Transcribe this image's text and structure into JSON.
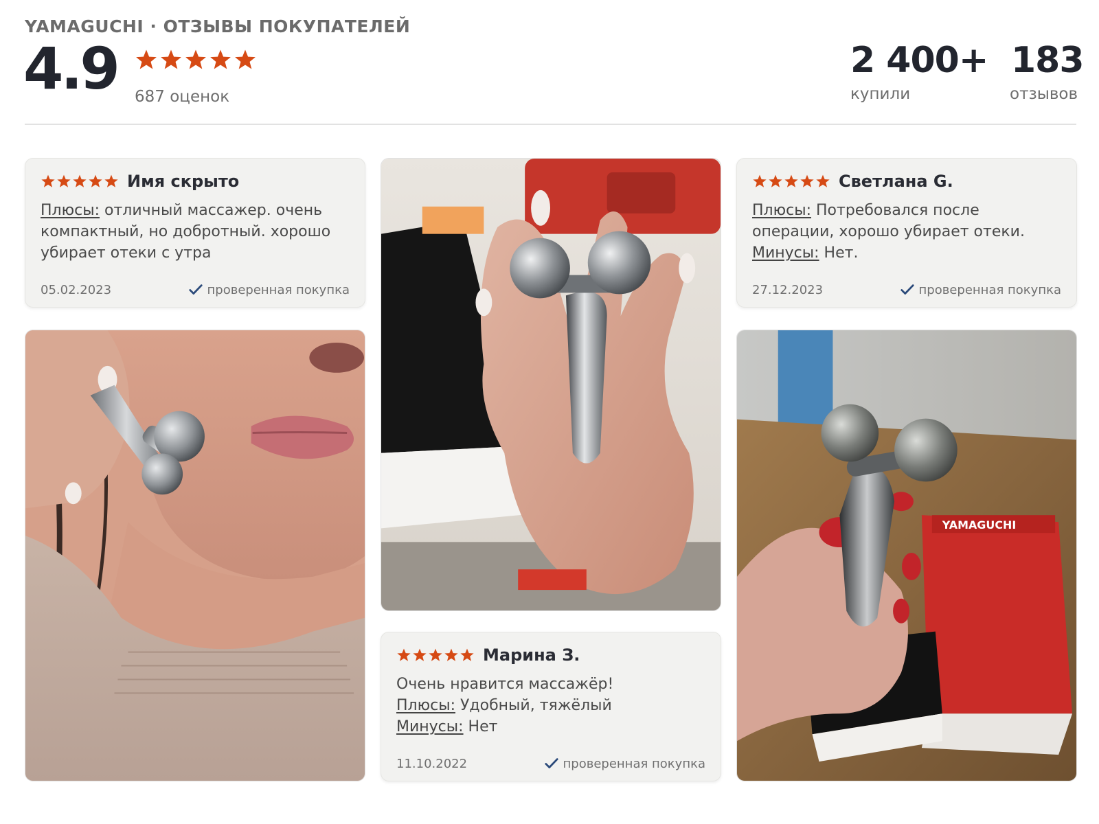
{
  "header": {
    "brand_title": "YAMAGUCHI · ОТЗЫВЫ ПОКУПАТЕЛЕЙ",
    "rating": "4.9",
    "stars": 5,
    "ratings_count": "687 оценок",
    "bought_value": "2 400+",
    "bought_label": "купили",
    "reviews_value": "183",
    "reviews_label": "отзывов"
  },
  "colors": {
    "star": "#d64a14",
    "check": "#2b4a7a",
    "card_bg": "#f2f2f0"
  },
  "reviews": [
    {
      "author": "Имя скрыто",
      "stars": 5,
      "pros_label": "Плюсы:",
      "pros_text": " отличный массажер. очень компактный, но добротный. хорошо убирает отеки с утра",
      "date": "05.02.2023",
      "verified": "проверенная покупка"
    },
    {
      "author": "Светлана G.",
      "stars": 5,
      "pros_label": "Плюсы:",
      "pros_text": " Потребовался после операции, хорошо убирает отеки.",
      "cons_label": "Минусы:",
      "cons_text": " Нет.",
      "date": "27.12.2023",
      "verified": "проверенная покупка"
    },
    {
      "author": "Марина З.",
      "stars": 5,
      "intro": "Очень нравится массажёр!",
      "pros_label": "Плюсы:",
      "pros_text": " Удобный, тяжёлый",
      "cons_label": "Минусы:",
      "cons_text": " Нет",
      "date": "11.10.2022",
      "verified": "проверенная покупка"
    }
  ],
  "photos": {
    "photo_3_box_label": "YAMAGUCHI"
  }
}
